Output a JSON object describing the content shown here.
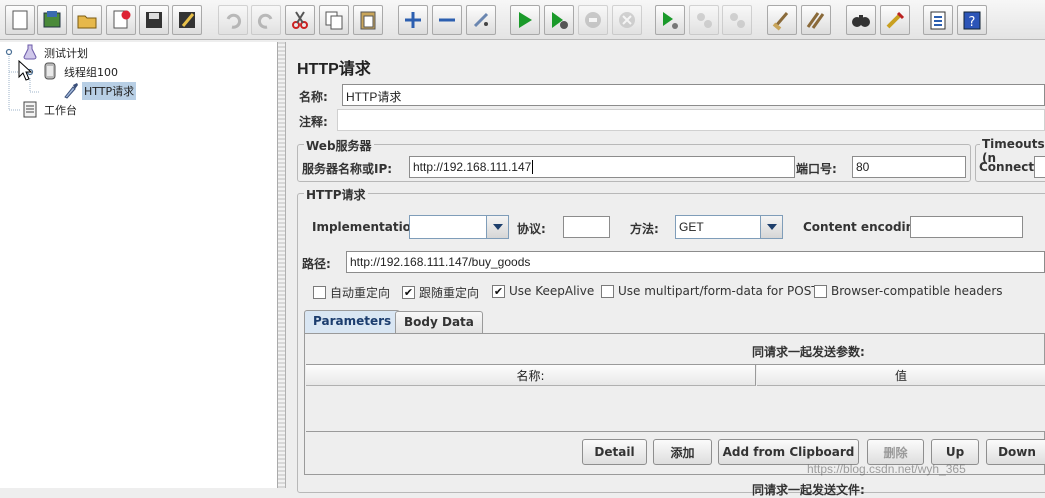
{
  "toolbar": {
    "buttons": [
      {
        "name": "new-icon"
      },
      {
        "name": "templates-icon"
      },
      {
        "name": "open-icon"
      },
      {
        "name": "close-icon"
      },
      {
        "name": "save-icon"
      },
      {
        "name": "save-as-icon"
      },
      {
        "name": "undo-icon"
      },
      {
        "name": "redo-icon"
      },
      {
        "name": "cut-icon"
      },
      {
        "name": "copy-icon"
      },
      {
        "name": "paste-icon"
      },
      {
        "name": "expand-icon"
      },
      {
        "name": "collapse-icon"
      },
      {
        "name": "toggle-icon"
      },
      {
        "name": "start-icon"
      },
      {
        "name": "start-no-pause-icon"
      },
      {
        "name": "stop-icon"
      },
      {
        "name": "shutdown-icon"
      },
      {
        "name": "remote-start-icon"
      },
      {
        "name": "remote-stop-icon"
      },
      {
        "name": "remote-shutdown-icon"
      },
      {
        "name": "clear-icon"
      },
      {
        "name": "clear-all-icon"
      },
      {
        "name": "search-icon"
      },
      {
        "name": "reset-search-icon"
      },
      {
        "name": "function-helper-icon"
      },
      {
        "name": "help-icon"
      }
    ]
  },
  "tree": {
    "plan": "测试计划",
    "thread_group": "线程组100",
    "http_request": "HTTP请求",
    "workbench": "工作台"
  },
  "panel": {
    "title": "HTTP请求",
    "name_label": "名称:",
    "name_value": "HTTP请求",
    "comment_label": "注释:",
    "comment_value": "",
    "web_server": {
      "legend": "Web服务器",
      "server_label": "服务器名称或IP:",
      "server_value": "http://192.168.111.147",
      "port_label": "端口号:",
      "port_value": "80"
    },
    "timeouts": {
      "legend": "Timeouts (n",
      "connect_label": "Connect:"
    },
    "http": {
      "legend": "HTTP请求",
      "impl_label": "Implementation:",
      "impl_value": "",
      "protocol_label": "协议:",
      "protocol_value": "",
      "method_label": "方法:",
      "method_value": "GET",
      "encoding_label": "Content encoding:",
      "encoding_value": "",
      "path_label": "路径:",
      "path_value": "http://192.168.111.147/buy_goods"
    },
    "checkboxes": [
      {
        "label": "自动重定向",
        "checked": false
      },
      {
        "label": "跟随重定向",
        "checked": true
      },
      {
        "label": "Use KeepAlive",
        "checked": true
      },
      {
        "label": "Use multipart/form-data for POST",
        "checked": false
      },
      {
        "label": "Browser-compatible headers",
        "checked": false
      }
    ],
    "tabs": {
      "parameters": "Parameters",
      "body": "Body Data"
    },
    "params": {
      "caption": "同请求一起发送参数:",
      "col_name": "名称:",
      "col_value": "值"
    },
    "buttons": {
      "detail": "Detail",
      "add": "添加",
      "clipboard": "Add from Clipboard",
      "delete": "删除",
      "up": "Up",
      "down": "Down"
    },
    "files_caption": "同请求一起发送文件:"
  },
  "watermark": "https://blog.csdn.net/wyh_365"
}
